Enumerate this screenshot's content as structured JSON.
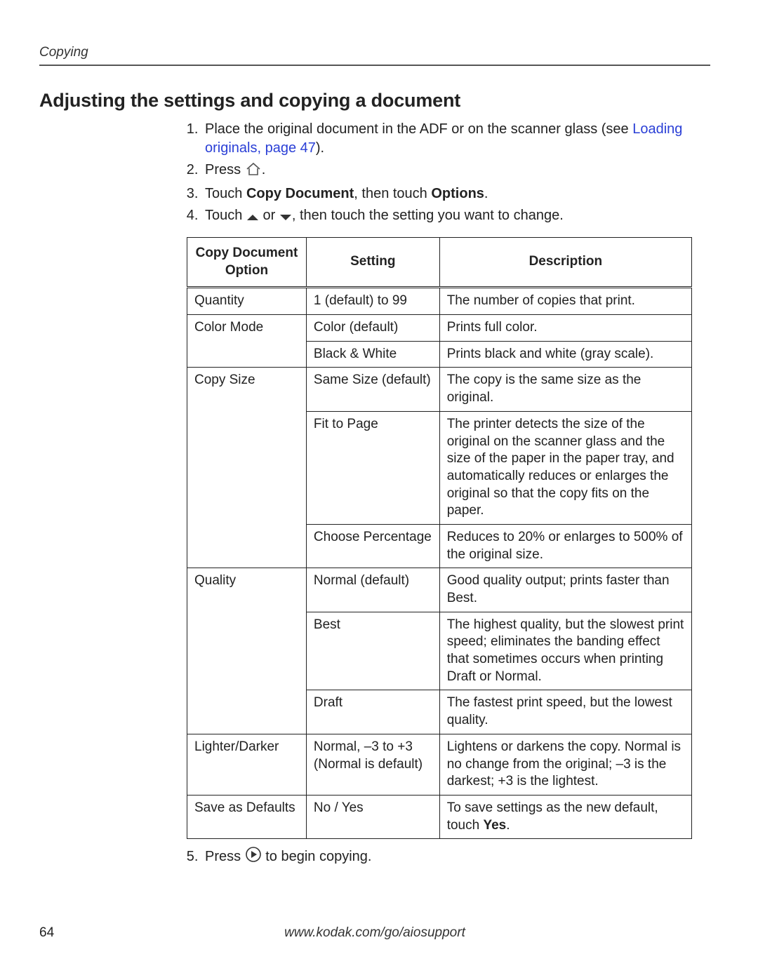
{
  "running_head": "Copying",
  "heading": "Adjusting the settings and copying a document",
  "steps": {
    "s1_pre": "Place the original document in the ADF or on the scanner glass (see ",
    "s1_link": "Loading originals, page 47",
    "s1_post": ").",
    "s2_pre": "Press ",
    "s2_post": ".",
    "s3_a": "Touch ",
    "s3_b": "Copy Document",
    "s3_c": ", then touch ",
    "s3_d": "Options",
    "s3_e": ".",
    "s4_a": "Touch ",
    "s4_b": " or ",
    "s4_c": ", then touch the setting you want to change.",
    "s5_a": "Press ",
    "s5_b": " to begin copying."
  },
  "table": {
    "headers": {
      "c1": "Copy Document Option",
      "c2": "Setting",
      "c3": "Description"
    },
    "rows": [
      {
        "opt": "Quantity",
        "setting": "1 (default) to 99",
        "desc": "The number of copies that print."
      },
      {
        "opt": "Color Mode",
        "setting": "Color (default)",
        "desc": "Prints full color."
      },
      {
        "opt": "",
        "setting": "Black & White",
        "desc": "Prints black and white (gray scale)."
      },
      {
        "opt": "Copy Size",
        "setting": "Same Size (default)",
        "desc": "The copy is the same size as the original."
      },
      {
        "opt": "",
        "setting": "Fit to Page",
        "desc": "The printer detects the size of the original on the scanner glass and the size of the paper in the paper tray, and automatically reduces or enlarges the original so that the copy fits on the paper."
      },
      {
        "opt": "",
        "setting": "Choose Percentage",
        "desc": "Reduces to 20% or enlarges to 500% of the original size."
      },
      {
        "opt": "Quality",
        "setting": "Normal (default)",
        "desc": "Good quality output; prints faster than Best."
      },
      {
        "opt": "",
        "setting": "Best",
        "desc": "The highest quality, but the slowest print speed; eliminates the banding effect that sometimes occurs when printing Draft or Normal."
      },
      {
        "opt": "",
        "setting": "Draft",
        "desc": "The fastest print speed, but the lowest quality."
      },
      {
        "opt": "Lighter/Darker",
        "setting": "Normal, –3 to +3 (Normal is default)",
        "desc": "Lightens or darkens the copy. Normal is no change from the original; –3 is the darkest; +3 is the lightest."
      },
      {
        "opt": "Save as Defaults",
        "setting": "No / Yes",
        "desc_pre": "To save settings as the new default, touch ",
        "desc_b": "Yes",
        "desc_post": "."
      }
    ]
  },
  "footer": {
    "page": "64",
    "url": "www.kodak.com/go/aiosupport"
  }
}
